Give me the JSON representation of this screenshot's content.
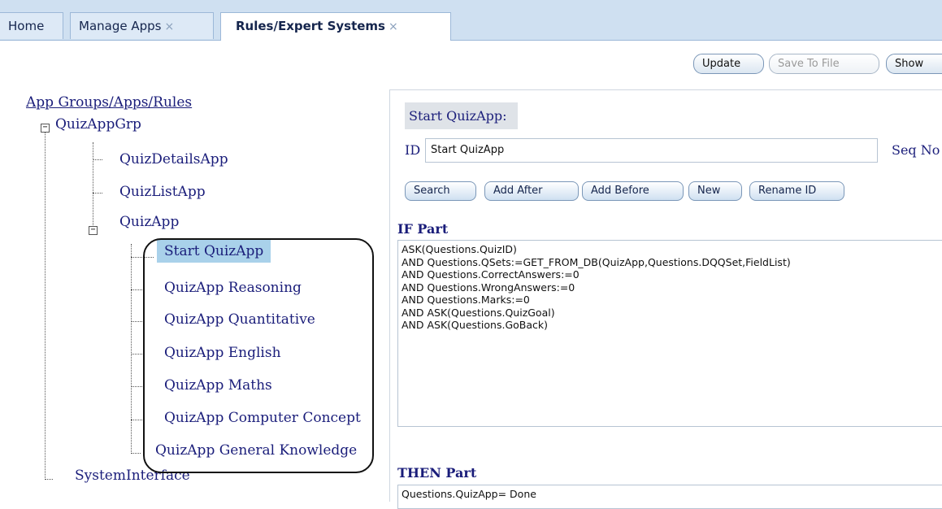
{
  "tabs": {
    "home": "Home",
    "manage_apps": "Manage Apps",
    "rules": "Rules/Expert Systems",
    "close_glyph": "×"
  },
  "toolbar": {
    "update": "Update",
    "save_to_file": "Save To File",
    "show": "Show"
  },
  "tree": {
    "root": "App Groups/Apps/Rules",
    "group": "QuizAppGrp",
    "apps": [
      "QuizDetailsApp",
      "QuizListApp",
      "QuizApp"
    ],
    "rules": [
      "Start QuizApp",
      "QuizApp Reasoning",
      "QuizApp Quantitative",
      "QuizApp English",
      "QuizApp Maths",
      "QuizApp Computer Concept",
      "QuizApp General Knowledge"
    ],
    "system": "SystemInterface",
    "collapse_glyph": "−"
  },
  "rule": {
    "title": "Start QuizApp:",
    "id_label": "ID",
    "id_value": "Start QuizApp",
    "seq_label": "Seq No",
    "buttons": {
      "search": "Search",
      "add_after": "Add After",
      "add_before": "Add Before",
      "new": "New",
      "rename": "Rename ID"
    },
    "if_label": "IF Part",
    "if_text": "ASK(Questions.QuizID)\nAND Questions.QSets:=GET_FROM_DB(QuizApp,Questions.DQQSet,FieldList)\nAND Questions.CorrectAnswers:=0\nAND Questions.WrongAnswers:=0\nAND Questions.Marks:=0\nAND ASK(Questions.QuizGoal)\nAND ASK(Questions.GoBack)",
    "then_label": "THEN Part",
    "then_text": "Questions.QuizApp= Done"
  }
}
